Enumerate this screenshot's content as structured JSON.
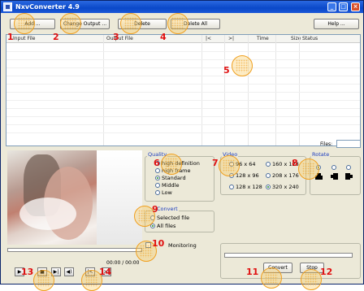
{
  "window": {
    "title": "NxvConverter 4.9",
    "controls": {
      "minimize": "_",
      "maximize": "□",
      "close": "×"
    }
  },
  "toolbar": {
    "add": "Add ...",
    "change_output": "Change Output ...",
    "delete": "Delete",
    "delete_all": "Delete All",
    "help": "Help ..."
  },
  "file_list": {
    "columns": [
      "Input File",
      "Output File",
      "|<",
      ">|",
      "Time",
      "Size",
      "Status"
    ],
    "rows": [],
    "files_label": "Files:",
    "files_count": ""
  },
  "player": {
    "time": "00:00 / 00:00",
    "controls": [
      {
        "name": "play-button",
        "glyph": "▶"
      },
      {
        "name": "stop-button",
        "glyph": "■"
      },
      {
        "name": "step-button",
        "glyph": "▶|"
      },
      {
        "name": "volume-button",
        "glyph": "◀)"
      },
      {
        "name": "mark-in-button",
        "glyph": "|<"
      },
      {
        "name": "mark-out-button",
        "glyph": ">|"
      }
    ]
  },
  "quality": {
    "label": "Quality",
    "options": [
      "high definition",
      "high frame",
      "Standard",
      "Middle",
      "Low"
    ],
    "selected": "Standard"
  },
  "convert_scope": {
    "label": "Convert",
    "options": [
      "Selected file",
      "All files"
    ],
    "selected": "All files"
  },
  "monitoring": {
    "label": "Monitoring",
    "checked": false
  },
  "video": {
    "label": "Video",
    "options": [
      "96 x 64",
      "160 x 128",
      "128 x 96",
      "208 x 176",
      "128 x 128",
      "320 x 240"
    ],
    "selected": "320 x 240"
  },
  "rotate": {
    "label": "Rotate",
    "selected_index": 0
  },
  "actions": {
    "convert": "Convert",
    "stop": "Stop"
  },
  "markers": [
    "1",
    "2",
    "3",
    "4",
    "5",
    "6",
    "7",
    "8",
    "9",
    "10",
    "11",
    "12",
    "13",
    "14"
  ],
  "colors": {
    "title_bar": "#0a48c8",
    "group_label": "#2040c0",
    "marker": "#f0a020",
    "marker_number": "#e01010"
  }
}
